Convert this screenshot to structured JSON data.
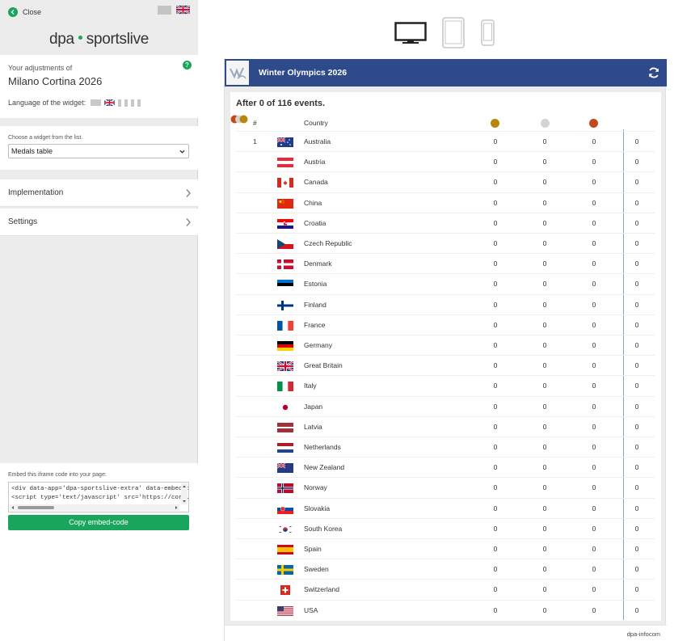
{
  "panel": {
    "close_label": "Close",
    "logo_left": "dpa",
    "logo_right": "sportslive",
    "adjust_label": "Your adjustments of",
    "event_title": "Milano Cortina 2026",
    "help_icon": "?",
    "language_label": "Language of the widget:",
    "widget_chooser_label": "Choose a widget from the list.",
    "widget_selected": "Medals table",
    "accordion": [
      {
        "label": "Implementation"
      },
      {
        "label": "Settings"
      }
    ],
    "embed_label": "Embed this iframe code into your page:",
    "embed_code_line1": "<div data-app='dpa-sportslive-extra' data-embed-type='ifra",
    "embed_code_line2": "<script type='text/javascript' src='https://core.dpa-infocom",
    "copy_button": "Copy embed-code"
  },
  "devices": [
    "desktop-icon",
    "tablet-icon",
    "phone-icon"
  ],
  "widget": {
    "title": "Winter Olympics 2026",
    "events_status": "After 0 of 116 events.",
    "col_rank": "#",
    "col_country": "Country",
    "footer_credit": "dpa-infocom",
    "colors": {
      "header": "#2e4a8a",
      "gold": "#b8860b",
      "silver": "#d4d4d4",
      "bronze": "#c4491a"
    },
    "rows": [
      {
        "rank": "1",
        "country": "Australia",
        "flag": "au",
        "gold": "0",
        "silver": "0",
        "bronze": "0",
        "total": "0"
      },
      {
        "rank": "",
        "country": "Austria",
        "flag": "at",
        "gold": "0",
        "silver": "0",
        "bronze": "0",
        "total": "0"
      },
      {
        "rank": "",
        "country": "Canada",
        "flag": "ca",
        "gold": "0",
        "silver": "0",
        "bronze": "0",
        "total": "0"
      },
      {
        "rank": "",
        "country": "China",
        "flag": "cn",
        "gold": "0",
        "silver": "0",
        "bronze": "0",
        "total": "0"
      },
      {
        "rank": "",
        "country": "Croatia",
        "flag": "hr",
        "gold": "0",
        "silver": "0",
        "bronze": "0",
        "total": "0"
      },
      {
        "rank": "",
        "country": "Czech Republic",
        "flag": "cz",
        "gold": "0",
        "silver": "0",
        "bronze": "0",
        "total": "0"
      },
      {
        "rank": "",
        "country": "Denmark",
        "flag": "dk",
        "gold": "0",
        "silver": "0",
        "bronze": "0",
        "total": "0"
      },
      {
        "rank": "",
        "country": "Estonia",
        "flag": "ee",
        "gold": "0",
        "silver": "0",
        "bronze": "0",
        "total": "0"
      },
      {
        "rank": "",
        "country": "Finland",
        "flag": "fi",
        "gold": "0",
        "silver": "0",
        "bronze": "0",
        "total": "0"
      },
      {
        "rank": "",
        "country": "France",
        "flag": "fr",
        "gold": "0",
        "silver": "0",
        "bronze": "0",
        "total": "0"
      },
      {
        "rank": "",
        "country": "Germany",
        "flag": "de",
        "gold": "0",
        "silver": "0",
        "bronze": "0",
        "total": "0"
      },
      {
        "rank": "",
        "country": "Great Britain",
        "flag": "gb",
        "gold": "0",
        "silver": "0",
        "bronze": "0",
        "total": "0"
      },
      {
        "rank": "",
        "country": "Italy",
        "flag": "it",
        "gold": "0",
        "silver": "0",
        "bronze": "0",
        "total": "0"
      },
      {
        "rank": "",
        "country": "Japan",
        "flag": "jp",
        "gold": "0",
        "silver": "0",
        "bronze": "0",
        "total": "0"
      },
      {
        "rank": "",
        "country": "Latvia",
        "flag": "lv",
        "gold": "0",
        "silver": "0",
        "bronze": "0",
        "total": "0"
      },
      {
        "rank": "",
        "country": "Netherlands",
        "flag": "nl",
        "gold": "0",
        "silver": "0",
        "bronze": "0",
        "total": "0"
      },
      {
        "rank": "",
        "country": "New Zealand",
        "flag": "nz",
        "gold": "0",
        "silver": "0",
        "bronze": "0",
        "total": "0"
      },
      {
        "rank": "",
        "country": "Norway",
        "flag": "no",
        "gold": "0",
        "silver": "0",
        "bronze": "0",
        "total": "0"
      },
      {
        "rank": "",
        "country": "Slovakia",
        "flag": "sk",
        "gold": "0",
        "silver": "0",
        "bronze": "0",
        "total": "0"
      },
      {
        "rank": "",
        "country": "South Korea",
        "flag": "kr",
        "gold": "0",
        "silver": "0",
        "bronze": "0",
        "total": "0"
      },
      {
        "rank": "",
        "country": "Spain",
        "flag": "es",
        "gold": "0",
        "silver": "0",
        "bronze": "0",
        "total": "0"
      },
      {
        "rank": "",
        "country": "Sweden",
        "flag": "se",
        "gold": "0",
        "silver": "0",
        "bronze": "0",
        "total": "0"
      },
      {
        "rank": "",
        "country": "Switzerland",
        "flag": "ch",
        "gold": "0",
        "silver": "0",
        "bronze": "0",
        "total": "0"
      },
      {
        "rank": "",
        "country": "USA",
        "flag": "us",
        "gold": "0",
        "silver": "0",
        "bronze": "0",
        "total": "0"
      }
    ]
  }
}
